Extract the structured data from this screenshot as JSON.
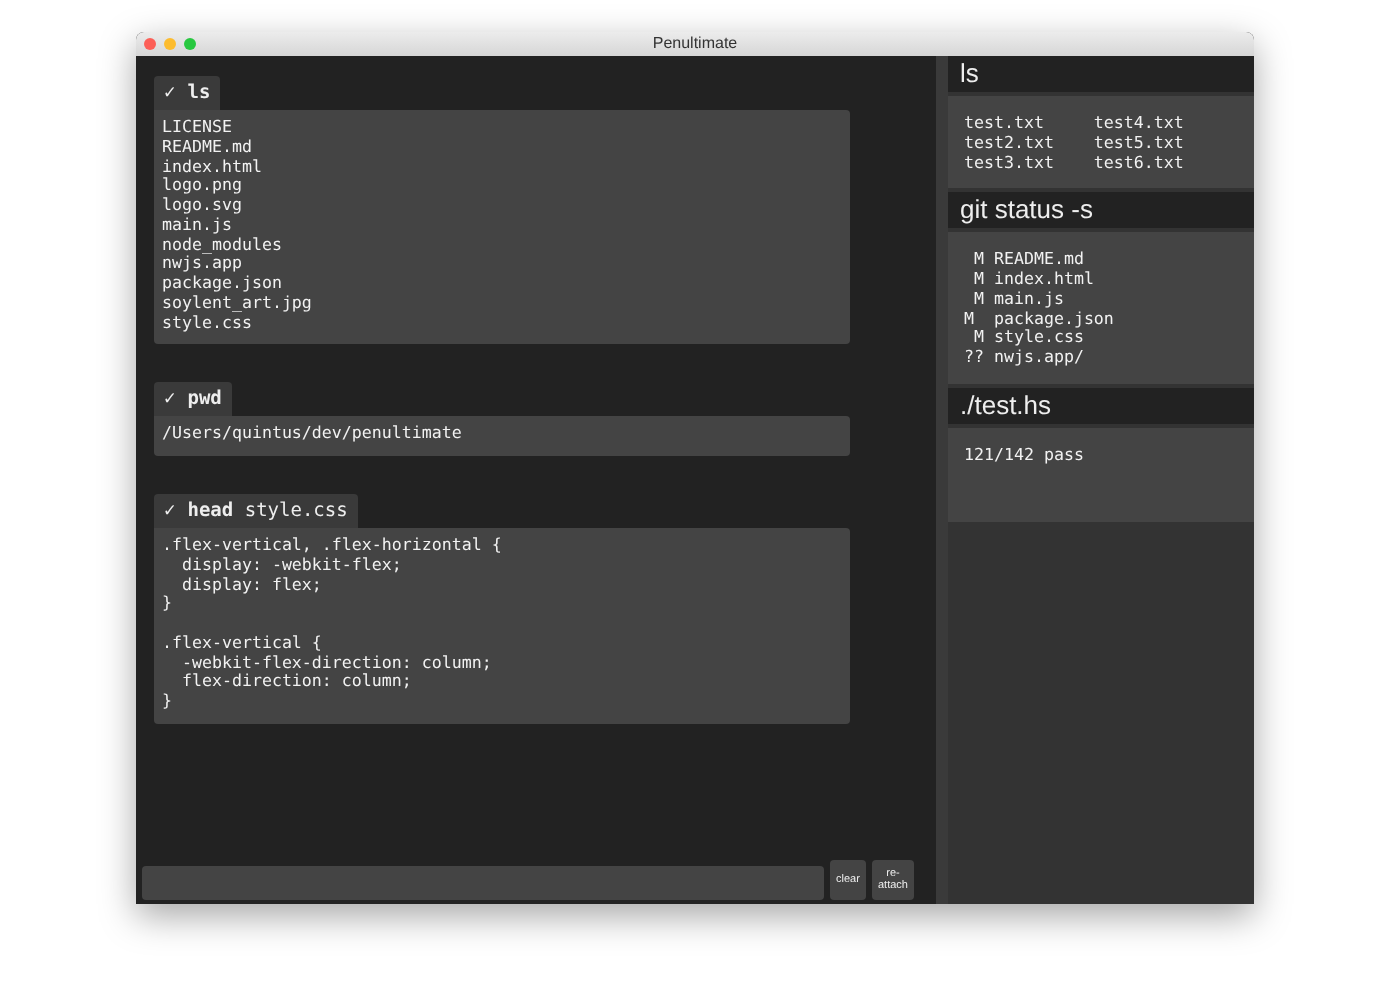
{
  "window": {
    "title": "Penultimate"
  },
  "blocks": [
    {
      "status": "✓",
      "command": "**ls**",
      "output": "LICENSE\nREADME.md\nindex.html\nlogo.png\nlogo.svg\nmain.js\nnode_modules\nnwjs.app\npackage.json\nsoylent_art.jpg\nstyle.css"
    },
    {
      "status": "✓",
      "command": "**pwd**",
      "output": "/Users/quintus/dev/penultimate"
    },
    {
      "status": "✓",
      "command": "**head** style.css",
      "output": ".flex-vertical, .flex-horizontal {\n  display: -webkit-flex;\n  display: flex;\n}\n\n.flex-vertical {\n  -webkit-flex-direction: column;\n  flex-direction: column;\n}\n"
    }
  ],
  "buttons": [
    "clear",
    "re-\nattach"
  ],
  "watchers": [
    {
      "title": "ls",
      "output": "test.txt     test4.txt\ntest2.txt    test5.txt\ntest3.txt    test6.txt"
    },
    {
      "title": "git status -s",
      "output": " M README.md\n M index.html\n M main.js\nM  package.json\n M style.css\n?? nwjs.app/"
    },
    {
      "title": "./test.hs",
      "output": "121/142 pass"
    }
  ]
}
